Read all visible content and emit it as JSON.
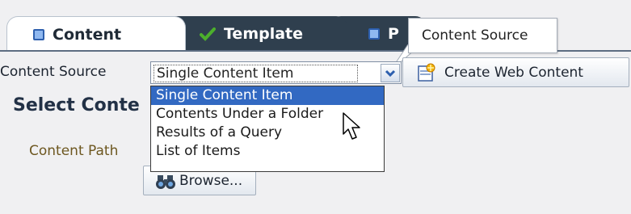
{
  "tabs": [
    {
      "label": "Content",
      "icon": "square-icon",
      "state": "active"
    },
    {
      "label": "Template",
      "icon": "checkmark-icon",
      "state": "inactive"
    },
    {
      "label": "P",
      "icon": "square-icon",
      "state": "inactive"
    }
  ],
  "tooltip": {
    "text": "Content Source"
  },
  "content_source": {
    "label": "Content Source",
    "selected": "Single Content Item",
    "options": [
      "Single Content Item",
      "Contents Under a Folder",
      "Results of a Query",
      "List of Items"
    ]
  },
  "create_button": {
    "label": "Create Web Content",
    "icon": "new-item-icon"
  },
  "section": {
    "heading": "Select Conte"
  },
  "content_path": {
    "label": "Content Path"
  },
  "browse_button": {
    "label": "Browse...",
    "icon": "binoculars-icon"
  },
  "colors": {
    "tab_dark": "#2f3f4e",
    "selection": "#3269c2",
    "path_label": "#6d5720"
  }
}
